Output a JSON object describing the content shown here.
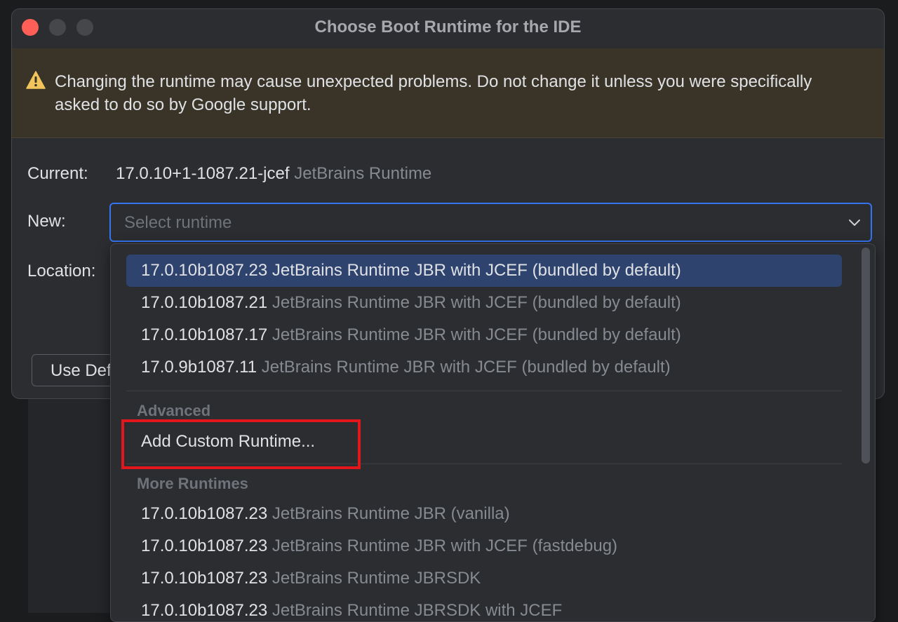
{
  "dialog": {
    "title": "Choose Boot Runtime for the IDE"
  },
  "banner": {
    "icon": "warning-triangle-icon",
    "text": "Changing the runtime may cause unexpected problems. Do not change it unless you were specifically asked to do so by Google support."
  },
  "form": {
    "current_label": "Current:",
    "current_version": "17.0.10+1-1087.21-jcef",
    "current_vendor": "JetBrains Runtime",
    "new_label": "New:",
    "new_placeholder": "Select runtime",
    "location_label": "Location:",
    "use_default_label": "Use Default Runtime"
  },
  "dropdown": {
    "items": [
      {
        "version": "17.0.10b1087.23",
        "desc": "JetBrains Runtime JBR with JCEF (bundled by default)",
        "selected": true
      },
      {
        "version": "17.0.10b1087.21",
        "desc": "JetBrains Runtime JBR with JCEF (bundled by default)"
      },
      {
        "version": "17.0.10b1087.17",
        "desc": "JetBrains Runtime JBR with JCEF (bundled by default)"
      },
      {
        "version": "17.0.9b1087.11",
        "desc": "JetBrains Runtime JBR with JCEF (bundled by default)"
      }
    ],
    "advanced_header": "Advanced",
    "add_custom_label": "Add Custom Runtime...",
    "more_header": "More Runtimes",
    "more_items": [
      {
        "version": "17.0.10b1087.23",
        "desc": "JetBrains Runtime JBR (vanilla)"
      },
      {
        "version": "17.0.10b1087.23",
        "desc": "JetBrains Runtime JBR with JCEF (fastdebug)"
      },
      {
        "version": "17.0.10b1087.23",
        "desc": "JetBrains Runtime JBRSDK"
      },
      {
        "version": "17.0.10b1087.23",
        "desc": "JetBrains Runtime JBRSDK with JCEF"
      }
    ]
  },
  "colors": {
    "accent": "#3574f0",
    "highlight": "#e2161b",
    "selection": "#2e436e"
  }
}
